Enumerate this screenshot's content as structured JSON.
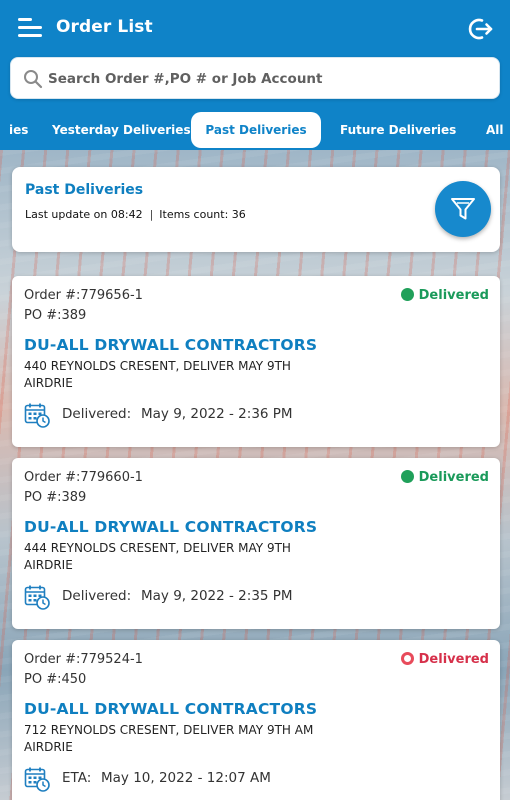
{
  "header": {
    "title": "Order List",
    "menu_icon": "hamburger-menu-icon",
    "logout_icon": "logout-icon"
  },
  "search": {
    "placeholder": "Search Order #,PO # or Job Account",
    "value": "",
    "icon": "search-icon"
  },
  "tabs": [
    {
      "label": "ies",
      "active": false
    },
    {
      "label": "Yesterday Deliveries",
      "active": false
    },
    {
      "label": "Past Deliveries",
      "active": true
    },
    {
      "label": "Future Deliveries",
      "active": false
    },
    {
      "label": "All",
      "active": false
    }
  ],
  "summary": {
    "title": "Past Deliveries",
    "last_update": "Last update on 08:42",
    "items_count": "Items count: 36",
    "filter_icon": "filter-icon"
  },
  "orders": [
    {
      "order_no": "Order #:779656-1",
      "po_no": "PO #:389",
      "status": "Delivered",
      "status_type": "delivered",
      "company": "DU-ALL DRYWALL CONTRACTORS",
      "address": "440  REYNOLDS CRESENT, DELIVER MAY 9TH",
      "city": "AIRDRIE",
      "delivery_label": "Delivered:",
      "delivery_value": "May 9, 2022 - 2:36 PM"
    },
    {
      "order_no": "Order #:779660-1",
      "po_no": "PO #:389",
      "status": "Delivered",
      "status_type": "delivered",
      "company": "DU-ALL DRYWALL CONTRACTORS",
      "address": "444 REYNOLDS CRESENT, DELIVER MAY 9TH",
      "city": "AIRDRIE",
      "delivery_label": "Delivered:",
      "delivery_value": "May 9, 2022 - 2:35 PM"
    },
    {
      "order_no": "Order #:779524-1",
      "po_no": "PO #:450",
      "status": "Delivered",
      "status_type": "alert",
      "company": "DU-ALL DRYWALL CONTRACTORS",
      "address": "712 REYNOLDS CRESENT, DELIVER MAY 9TH AM",
      "city": "AIRDRIE",
      "delivery_label": "ETA:",
      "delivery_value": "May 10, 2022 - 12:07 AM"
    }
  ],
  "colors": {
    "primary": "#0f83c8",
    "title_blue": "#0f7fc0",
    "status_green": "#20a05a",
    "status_red": "#e84b5b"
  }
}
